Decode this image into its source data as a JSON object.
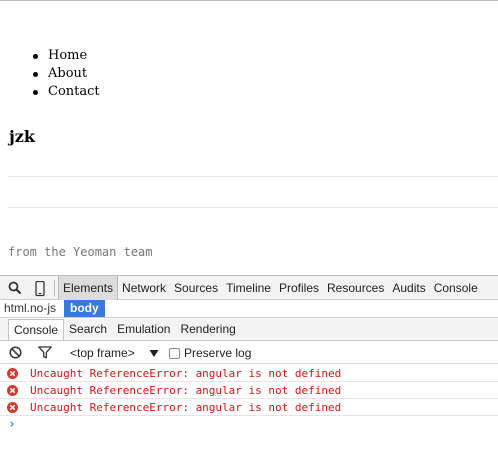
{
  "page": {
    "nav": [
      "Home",
      "About",
      "Contact"
    ],
    "title": "jzk",
    "footer": "from the Yeoman team"
  },
  "devtools": {
    "toolbar_icons": [
      "search-icon",
      "mobile-device-icon"
    ],
    "tabs": [
      "Elements",
      "Network",
      "Sources",
      "Timeline",
      "Profiles",
      "Resources",
      "Audits",
      "Console"
    ],
    "active_tab": "Elements",
    "breadcrumb": [
      "html.no-js",
      "body"
    ],
    "selected_crumb": "body",
    "drawer_tabs": [
      "Console",
      "Search",
      "Emulation",
      "Rendering"
    ],
    "active_drawer_tab": "Console",
    "console_toolbar": {
      "clear_icon": "clear-no-entry-icon",
      "filter_icon": "filter-funnel-icon",
      "frame": "<top frame>",
      "preserve_log": "Preserve log",
      "preserve_log_checked": false
    },
    "messages": [
      {
        "level": "error",
        "text": "Uncaught ReferenceError: angular is not defined"
      },
      {
        "level": "error",
        "text": "Uncaught ReferenceError: angular is not defined"
      },
      {
        "level": "error",
        "text": "Uncaught ReferenceError: angular is not defined"
      }
    ],
    "colors": {
      "error": "#dd1111",
      "selected_crumb_bg": "#3879d9",
      "prompt": "#367cf1"
    }
  }
}
